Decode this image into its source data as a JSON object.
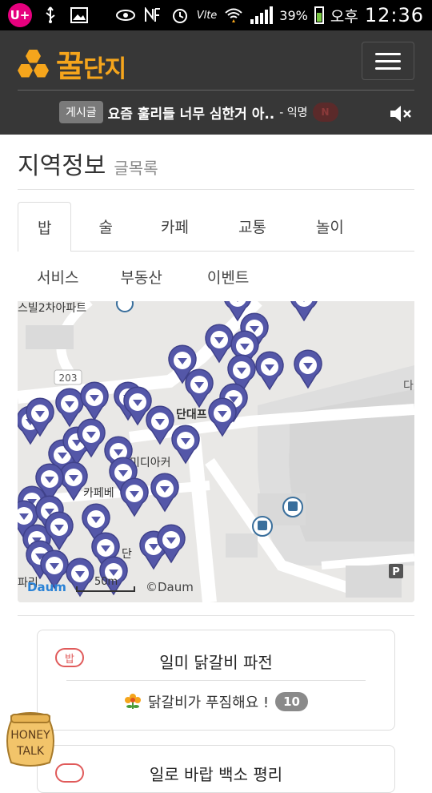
{
  "status_bar": {
    "carrier_badge": "U+",
    "battery_percent": "39%",
    "ampm": "오후",
    "time": "12:36",
    "network": "Vlte"
  },
  "header": {
    "logo_main": "꿀",
    "logo_sub": "단지",
    "ticker": {
      "tag": "게시글",
      "title": "요즘 훌리들 너무 심한거 아..",
      "meta": "- 익명",
      "badge": "N"
    }
  },
  "page": {
    "title": "지역정보",
    "subtitle": "글목록"
  },
  "tabs": {
    "row1": [
      "밥",
      "술",
      "카페",
      "교통",
      "놀이"
    ],
    "row2": [
      "서비스",
      "부동산",
      "이벤트"
    ],
    "active": "밥"
  },
  "map": {
    "labels": {
      "apartment": "스빌2차아파트",
      "road_number": "203",
      "dandae": "단대프",
      "media": "미디아커",
      "cafe": "카페베",
      "da": "다",
      "dan": "단",
      "paris": "파리",
      "scale": "50m",
      "copyright": "©Daum",
      "daum_logo": "Daum",
      "parking": "P"
    }
  },
  "cards": [
    {
      "badge": "밥",
      "title": "일미 닭갈비 파전",
      "review": "닭갈비가 푸짐해요 !",
      "count": "10"
    },
    {
      "badge": "",
      "title": "일로 바랍 백소 평리"
    }
  ],
  "honey_talk": {
    "line1": "HONEY",
    "line2": "TALK"
  },
  "colors": {
    "header_bg": "#373737",
    "brand_orange": "#f5a51c",
    "badge_red": "#e05a5a",
    "map_pin": "#5457a8"
  }
}
